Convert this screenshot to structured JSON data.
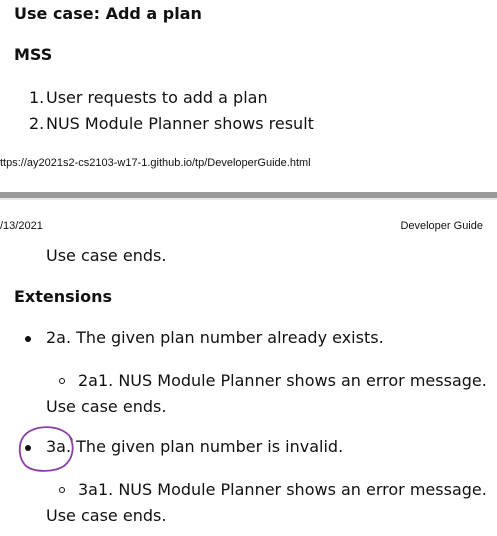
{
  "page1": {
    "heading": "Use case: Add a plan",
    "mss_heading": "MSS",
    "steps": [
      {
        "num": "1.",
        "text": "User requests to add a plan"
      },
      {
        "num": "2.",
        "text": "NUS Module Planner shows result"
      }
    ],
    "footer_url": "ttps://ay2021s2-cs2103-w17-1.github.io/tp/DeveloperGuide.html"
  },
  "page2": {
    "header_date": "/13/2021",
    "header_title": "Developer Guide",
    "use_case_ends": "Use case ends.",
    "extensions_heading": "Extensions",
    "extensions": [
      {
        "label": "2a. The given plan number already exists.",
        "sub": "2a1. NUS Module Planner shows an error message.",
        "ends": "Use case ends."
      },
      {
        "label": "3a. The given plan number is invalid.",
        "sub": "3a1. NUS Module Planner shows an error message.",
        "ends": "Use case ends."
      }
    ]
  },
  "annotation_color": "#8a3fa6"
}
